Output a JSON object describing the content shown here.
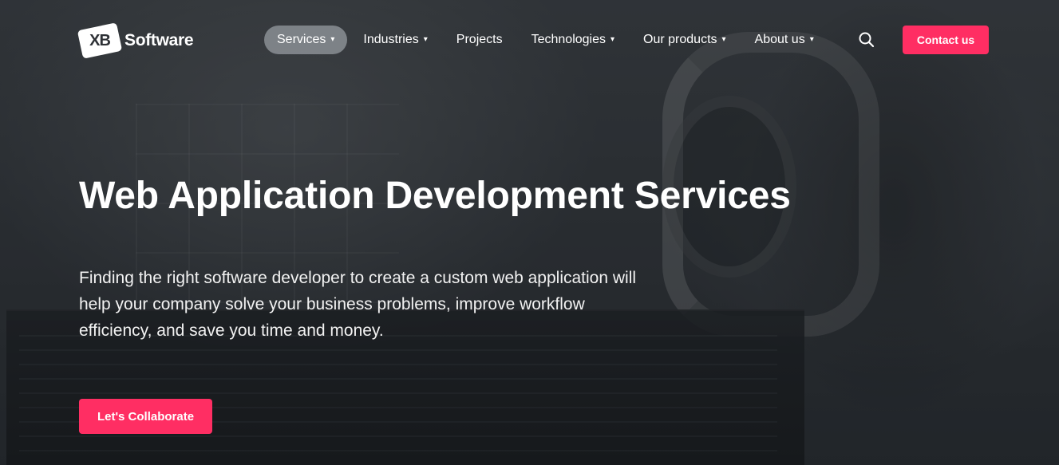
{
  "brand": {
    "logo_mark": "XB",
    "name": "Software"
  },
  "nav": {
    "items": [
      {
        "label": "Services",
        "chevron": "▾",
        "active": true
      },
      {
        "label": "Industries",
        "chevron": "▾",
        "active": false
      },
      {
        "label": "Projects",
        "chevron": "",
        "active": false
      },
      {
        "label": "Technologies",
        "chevron": "▾",
        "active": false
      },
      {
        "label": "Our products",
        "chevron": "▾",
        "active": false
      },
      {
        "label": "About us",
        "chevron": "▾",
        "active": false
      }
    ],
    "search_icon": "search-icon",
    "contact_label": "Contact us"
  },
  "hero": {
    "title": "Web Application Development Services",
    "description": "Finding the right software developer to create a custom web application will help your company solve your business problems, improve workflow efficiency, and save you time and money.",
    "cta_label": "Let's Collaborate"
  },
  "colors": {
    "accent": "#ff2e63",
    "active_pill": "#969ba0",
    "text": "#ffffff"
  }
}
